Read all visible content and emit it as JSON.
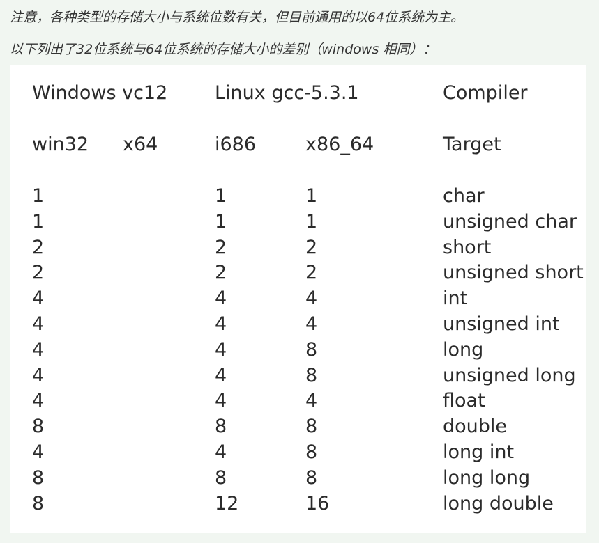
{
  "notes": {
    "line1": "注意，各种类型的存储大小与系统位数有关，但目前通用的以64位系统为主。",
    "line2": "以下列出了32位系统与64位系统的存储大小的差别（windows 相同）："
  },
  "table": {
    "header1": {
      "windows": "Windows vc12",
      "linux": "Linux gcc-5.3.1",
      "compiler": "Compiler"
    },
    "header2": {
      "win32": "win32",
      "x64": "x64",
      "i686": "i686",
      "x86_64": "x86_64",
      "target": "Target"
    },
    "rows": [
      {
        "win32": "1",
        "i686": "1",
        "x86_64": "1",
        "type": "char"
      },
      {
        "win32": "1",
        "i686": "1",
        "x86_64": "1",
        "type": "unsigned char"
      },
      {
        "win32": "2",
        "i686": "2",
        "x86_64": "2",
        "type": "short"
      },
      {
        "win32": "2",
        "i686": "2",
        "x86_64": "2",
        "type": "unsigned short"
      },
      {
        "win32": "4",
        "i686": "4",
        "x86_64": "4",
        "type": "int"
      },
      {
        "win32": "4",
        "i686": "4",
        "x86_64": "4",
        "type": "unsigned int"
      },
      {
        "win32": "4",
        "i686": "4",
        "x86_64": "8",
        "type": "long"
      },
      {
        "win32": "4",
        "i686": "4",
        "x86_64": "8",
        "type": "unsigned long"
      },
      {
        "win32": "4",
        "i686": "4",
        "x86_64": "4",
        "type": "float"
      },
      {
        "win32": "8",
        "i686": "8",
        "x86_64": "8",
        "type": "double"
      },
      {
        "win32": "4",
        "i686": "4",
        "x86_64": "8",
        "type": "long int"
      },
      {
        "win32": "8",
        "i686": "8",
        "x86_64": "8",
        "type": "long long"
      },
      {
        "win32": "8",
        "i686": "12",
        "x86_64": "16",
        "type": "long double"
      }
    ]
  }
}
